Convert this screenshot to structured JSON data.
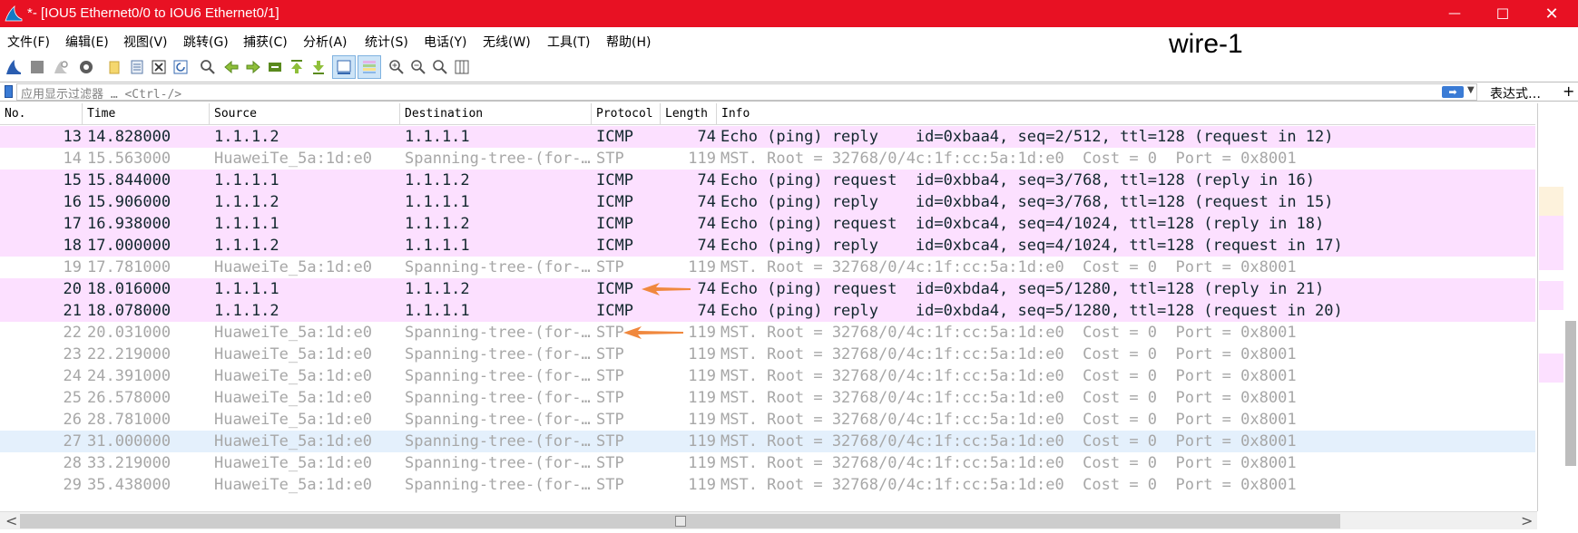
{
  "window": {
    "title": "*- [IOU5 Ethernet0/0 to IOU6 Ethernet0/1]",
    "controls": {
      "minimize": "—",
      "maximize": "☐",
      "close": "✕"
    }
  },
  "menubar": {
    "items": [
      "文件(F)",
      "编辑(E)",
      "视图(V)",
      "跳转(G)",
      "捕获(C)",
      "分析(A)",
      "统计(S)",
      "电话(Y)",
      "无线(W)",
      "工具(T)",
      "帮助(H)"
    ]
  },
  "annotation": "wire-1",
  "toolbar": {
    "icons": [
      "shark-fin-start-icon",
      "stop-icon",
      "restart-icon",
      "capture-options-gear-icon",
      "open-folder-icon",
      "save-file-icon",
      "close-file-icon",
      "reload-icon",
      "find-icon",
      "back-arrow-icon",
      "forward-arrow-icon",
      "go-to-packet-icon",
      "first-packet-icon",
      "last-packet-icon",
      "autoscroll-icon",
      "colorize-icon",
      "zoom-in-icon",
      "zoom-out-icon",
      "normal-size-icon",
      "resize-columns-icon"
    ]
  },
  "filter": {
    "placeholder": "应用显示过滤器 … <Ctrl-/>",
    "apply_arrow": "➡",
    "dropdown": "▼",
    "expression_label": "表达式…",
    "add_button": "+"
  },
  "columns": [
    "No.",
    "Time",
    "Source",
    "Destination",
    "Protocol",
    "Length",
    "Info"
  ],
  "packets": [
    {
      "no": "13",
      "time": "14.828000",
      "src": "1.1.1.2",
      "dst": "1.1.1.1",
      "proto": "ICMP",
      "len": "74",
      "info": "Echo (ping) reply    id=0xbaa4, seq=2/512, ttl=128 (request in 12)",
      "kind": "icmp"
    },
    {
      "no": "14",
      "time": "15.563000",
      "src": "HuaweiTe_5a:1d:e0",
      "dst": "Spanning-tree-(for-…",
      "proto": "STP",
      "len": "119",
      "info": "MST. Root = 32768/0/4c:1f:cc:5a:1d:e0  Cost = 0  Port = 0x8001",
      "kind": "stp"
    },
    {
      "no": "15",
      "time": "15.844000",
      "src": "1.1.1.1",
      "dst": "1.1.1.2",
      "proto": "ICMP",
      "len": "74",
      "info": "Echo (ping) request  id=0xbba4, seq=3/768, ttl=128 (reply in 16)",
      "kind": "icmp"
    },
    {
      "no": "16",
      "time": "15.906000",
      "src": "1.1.1.2",
      "dst": "1.1.1.1",
      "proto": "ICMP",
      "len": "74",
      "info": "Echo (ping) reply    id=0xbba4, seq=3/768, ttl=128 (request in 15)",
      "kind": "icmp"
    },
    {
      "no": "17",
      "time": "16.938000",
      "src": "1.1.1.1",
      "dst": "1.1.1.2",
      "proto": "ICMP",
      "len": "74",
      "info": "Echo (ping) request  id=0xbca4, seq=4/1024, ttl=128 (reply in 18)",
      "kind": "icmp"
    },
    {
      "no": "18",
      "time": "17.000000",
      "src": "1.1.1.2",
      "dst": "1.1.1.1",
      "proto": "ICMP",
      "len": "74",
      "info": "Echo (ping) reply    id=0xbca4, seq=4/1024, ttl=128 (request in 17)",
      "kind": "icmp"
    },
    {
      "no": "19",
      "time": "17.781000",
      "src": "HuaweiTe_5a:1d:e0",
      "dst": "Spanning-tree-(for-…",
      "proto": "STP",
      "len": "119",
      "info": "MST. Root = 32768/0/4c:1f:cc:5a:1d:e0  Cost = 0  Port = 0x8001",
      "kind": "stp"
    },
    {
      "no": "20",
      "time": "18.016000",
      "src": "1.1.1.1",
      "dst": "1.1.1.2",
      "proto": "ICMP",
      "len": "74",
      "info": "Echo (ping) request  id=0xbda4, seq=5/1280, ttl=128 (reply in 21)",
      "kind": "icmp"
    },
    {
      "no": "21",
      "time": "18.078000",
      "src": "1.1.1.2",
      "dst": "1.1.1.1",
      "proto": "ICMP",
      "len": "74",
      "info": "Echo (ping) reply    id=0xbda4, seq=5/1280, ttl=128 (request in 20)",
      "kind": "icmp"
    },
    {
      "no": "22",
      "time": "20.031000",
      "src": "HuaweiTe_5a:1d:e0",
      "dst": "Spanning-tree-(for-…",
      "proto": "STP",
      "len": "119",
      "info": "MST. Root = 32768/0/4c:1f:cc:5a:1d:e0  Cost = 0  Port = 0x8001",
      "kind": "stp"
    },
    {
      "no": "23",
      "time": "22.219000",
      "src": "HuaweiTe_5a:1d:e0",
      "dst": "Spanning-tree-(for-…",
      "proto": "STP",
      "len": "119",
      "info": "MST. Root = 32768/0/4c:1f:cc:5a:1d:e0  Cost = 0  Port = 0x8001",
      "kind": "stp"
    },
    {
      "no": "24",
      "time": "24.391000",
      "src": "HuaweiTe_5a:1d:e0",
      "dst": "Spanning-tree-(for-…",
      "proto": "STP",
      "len": "119",
      "info": "MST. Root = 32768/0/4c:1f:cc:5a:1d:e0  Cost = 0  Port = 0x8001",
      "kind": "stp"
    },
    {
      "no": "25",
      "time": "26.578000",
      "src": "HuaweiTe_5a:1d:e0",
      "dst": "Spanning-tree-(for-…",
      "proto": "STP",
      "len": "119",
      "info": "MST. Root = 32768/0/4c:1f:cc:5a:1d:e0  Cost = 0  Port = 0x8001",
      "kind": "stp"
    },
    {
      "no": "26",
      "time": "28.781000",
      "src": "HuaweiTe_5a:1d:e0",
      "dst": "Spanning-tree-(for-…",
      "proto": "STP",
      "len": "119",
      "info": "MST. Root = 32768/0/4c:1f:cc:5a:1d:e0  Cost = 0  Port = 0x8001",
      "kind": "stp"
    },
    {
      "no": "27",
      "time": "31.000000",
      "src": "HuaweiTe_5a:1d:e0",
      "dst": "Spanning-tree-(for-…",
      "proto": "STP",
      "len": "119",
      "info": "MST. Root = 32768/0/4c:1f:cc:5a:1d:e0  Cost = 0  Port = 0x8001",
      "kind": "sel"
    },
    {
      "no": "28",
      "time": "33.219000",
      "src": "HuaweiTe_5a:1d:e0",
      "dst": "Spanning-tree-(for-…",
      "proto": "STP",
      "len": "119",
      "info": "MST. Root = 32768/0/4c:1f:cc:5a:1d:e0  Cost = 0  Port = 0x8001",
      "kind": "stp"
    },
    {
      "no": "29",
      "time": "35.438000",
      "src": "HuaweiTe_5a:1d:e0",
      "dst": "Spanning-tree-(for-…",
      "proto": "STP",
      "len": "119",
      "info": "MST. Root = 32768/0/4c:1f:cc:5a:1d:e0  Cost = 0  Port = 0x8001",
      "kind": "stp"
    }
  ],
  "colors": {
    "titlebar": "#e81123",
    "icmp_row": "#fce0ff",
    "selected_row": "#e4f0fc",
    "stp_text": "#a7a7a7",
    "annotation_arrow": "#f0883e"
  },
  "scrollbars": {
    "left_arrow": "<",
    "right_arrow": ">"
  }
}
